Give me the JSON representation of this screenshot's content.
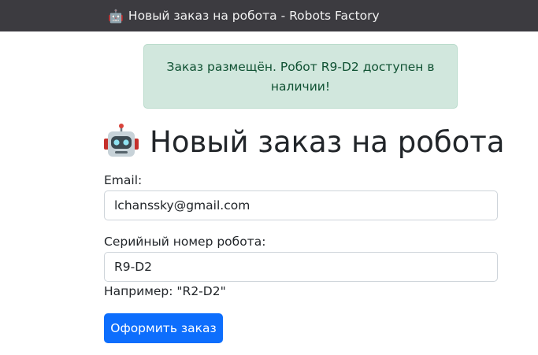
{
  "window": {
    "title_icon": "robot-emoji",
    "title_icon_glyph": "🤖",
    "title": "Новый заказ на робота - Robots Factory"
  },
  "alert": {
    "message": "Заказ размещён. Робот R9-D2 доступен в наличии!",
    "color": "#0f5132",
    "background": "#d1e7dd"
  },
  "page": {
    "heading_icon": "robot-icon",
    "heading": "Новый заказ на робота"
  },
  "form": {
    "email_label": "Email:",
    "email_value": "lchanssky@gmail.com",
    "serial_label": "Серийный номер робота:",
    "serial_value": "R9-D2",
    "serial_hint": "Например: \"R2-D2\"",
    "submit_label": "Оформить заказ",
    "submit_color": "#0d6efd"
  }
}
